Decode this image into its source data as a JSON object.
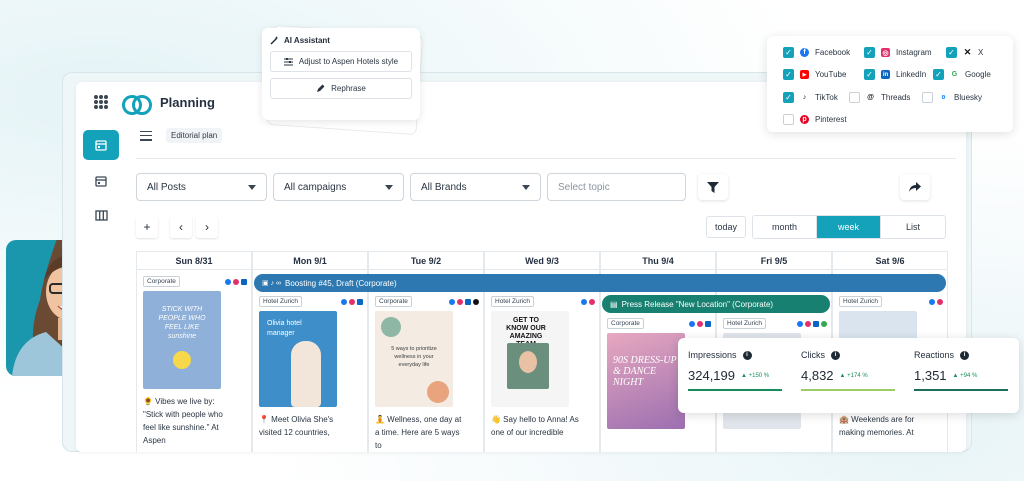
{
  "app": {
    "title": "Planning",
    "breadcrumb": "Editorial plan"
  },
  "filters": {
    "posts": "All Posts",
    "campaigns": "All campaigns",
    "brands": "All Brands",
    "topic_placeholder": "Select topic"
  },
  "nav": {
    "add": "+",
    "prev": "‹",
    "next": "›",
    "today": "today"
  },
  "views": [
    {
      "label": "month",
      "active": false
    },
    {
      "label": "week",
      "active": true
    },
    {
      "label": "List",
      "active": false
    }
  ],
  "days": [
    "Sun 8/31",
    "Mon 9/1",
    "Tue 9/2",
    "Wed 9/3",
    "Thu 9/4",
    "Fri 9/5",
    "Sat 9/6"
  ],
  "events": {
    "boosting": "Boosting #45, Draft (Corporate)",
    "press_release": "Press Release \"New Location\" (Corporate)"
  },
  "posts": [
    {
      "tag": "Corporate",
      "thumb_text": "STICK WITH PEOPLE WHO FEEL LIKE sunshine",
      "text": "🌻 Vibes we live by: \"Stick with people who feel like sunshine.\" At Aspen"
    },
    {
      "tag": "Hotel Zurich",
      "thumb_text": "Olivia hotel manager",
      "text": "📍 Meet Olivia She's visited 12 countries,"
    },
    {
      "tag": "Corporate",
      "thumb_text": "5 ways to prioritize wellness in your everyday life",
      "text": "🧘 Wellness, one day at a time. Here are 5 ways to"
    },
    {
      "tag": "Hotel Zurich",
      "thumb_text": "GET TO KNOW OUR AMAZING TEAM",
      "text": "👋 Say hello to Anna! As one of our incredible"
    },
    {
      "tag": "Corporate",
      "thumb_text": "90S DRESS-UP & DANCE NIGHT",
      "text": ""
    },
    {
      "tag": "Hotel Zurich",
      "thumb_text": "",
      "text": ""
    },
    {
      "tag": "Hotel Zurich",
      "thumb_text": "",
      "text": "🏨 Weekends are for making memories. At"
    }
  ],
  "ai_assistant": {
    "title": "AI Assistant",
    "adjust": "Adjust to Aspen Hotels style",
    "rephrase": "Rephrase"
  },
  "networks": [
    {
      "name": "Facebook",
      "checked": true,
      "color": "#1877f2"
    },
    {
      "name": "Instagram",
      "checked": true,
      "color": "#e1306c"
    },
    {
      "name": "X",
      "checked": true,
      "color": "#111111"
    },
    {
      "name": "YouTube",
      "checked": true,
      "color": "#ff0000"
    },
    {
      "name": "LinkedIn",
      "checked": true,
      "color": "#0a66c2"
    },
    {
      "name": "Google",
      "checked": true,
      "color": "#34a853"
    },
    {
      "name": "TikTok",
      "checked": true,
      "color": "#111111"
    },
    {
      "name": "Threads",
      "checked": false,
      "color": "#111111"
    },
    {
      "name": "Bluesky",
      "checked": false,
      "color": "#1185fe"
    },
    {
      "name": "Pinterest",
      "checked": false,
      "color": "#e60023"
    }
  ],
  "stats": [
    {
      "label": "Impressions",
      "value": "324,199",
      "delta": "+150 %",
      "color": "#178e5a"
    },
    {
      "label": "Clicks",
      "value": "4,832",
      "delta": "+174 %",
      "color": "#9ccc65"
    },
    {
      "label": "Reactions",
      "value": "1,351",
      "delta": "+94 %",
      "color": "#1e6e60"
    }
  ],
  "colors": {
    "accent": "#14a2bb",
    "event_blue": "#2d78b0",
    "event_green": "#178070"
  }
}
